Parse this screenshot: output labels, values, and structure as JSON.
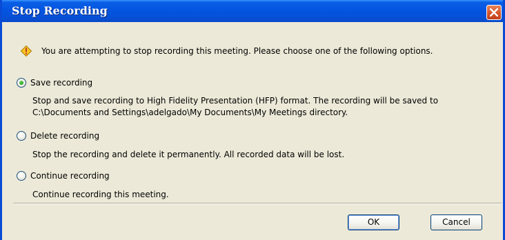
{
  "dialog": {
    "title": "Stop Recording",
    "message": "You are attempting to stop recording this meeting. Please choose one of the following options."
  },
  "options": [
    {
      "label": "Save recording",
      "selected": true,
      "description_lines": [
        "Stop and save recording to High Fidelity Presentation (HFP) format. The recording will be saved to",
        "C:\\Documents and Settings\\adelgado\\My Documents\\My Meetings directory."
      ]
    },
    {
      "label": "Delete recording",
      "selected": false,
      "description_lines": [
        "Stop the recording and delete it permanently. All recorded data will be lost."
      ]
    },
    {
      "label": "Continue recording",
      "selected": false,
      "description_lines": [
        "Continue recording this meeting."
      ]
    }
  ],
  "buttons": {
    "ok_label": "OK",
    "cancel_label": "Cancel"
  },
  "icons": {
    "warning": "warning-diamond-icon",
    "close": "close-icon"
  },
  "colors": {
    "titlebar": "#0454E0",
    "dialog_background": "#ECE9D8",
    "close_button": "#D8582B",
    "selected_radio": "#21A121"
  }
}
